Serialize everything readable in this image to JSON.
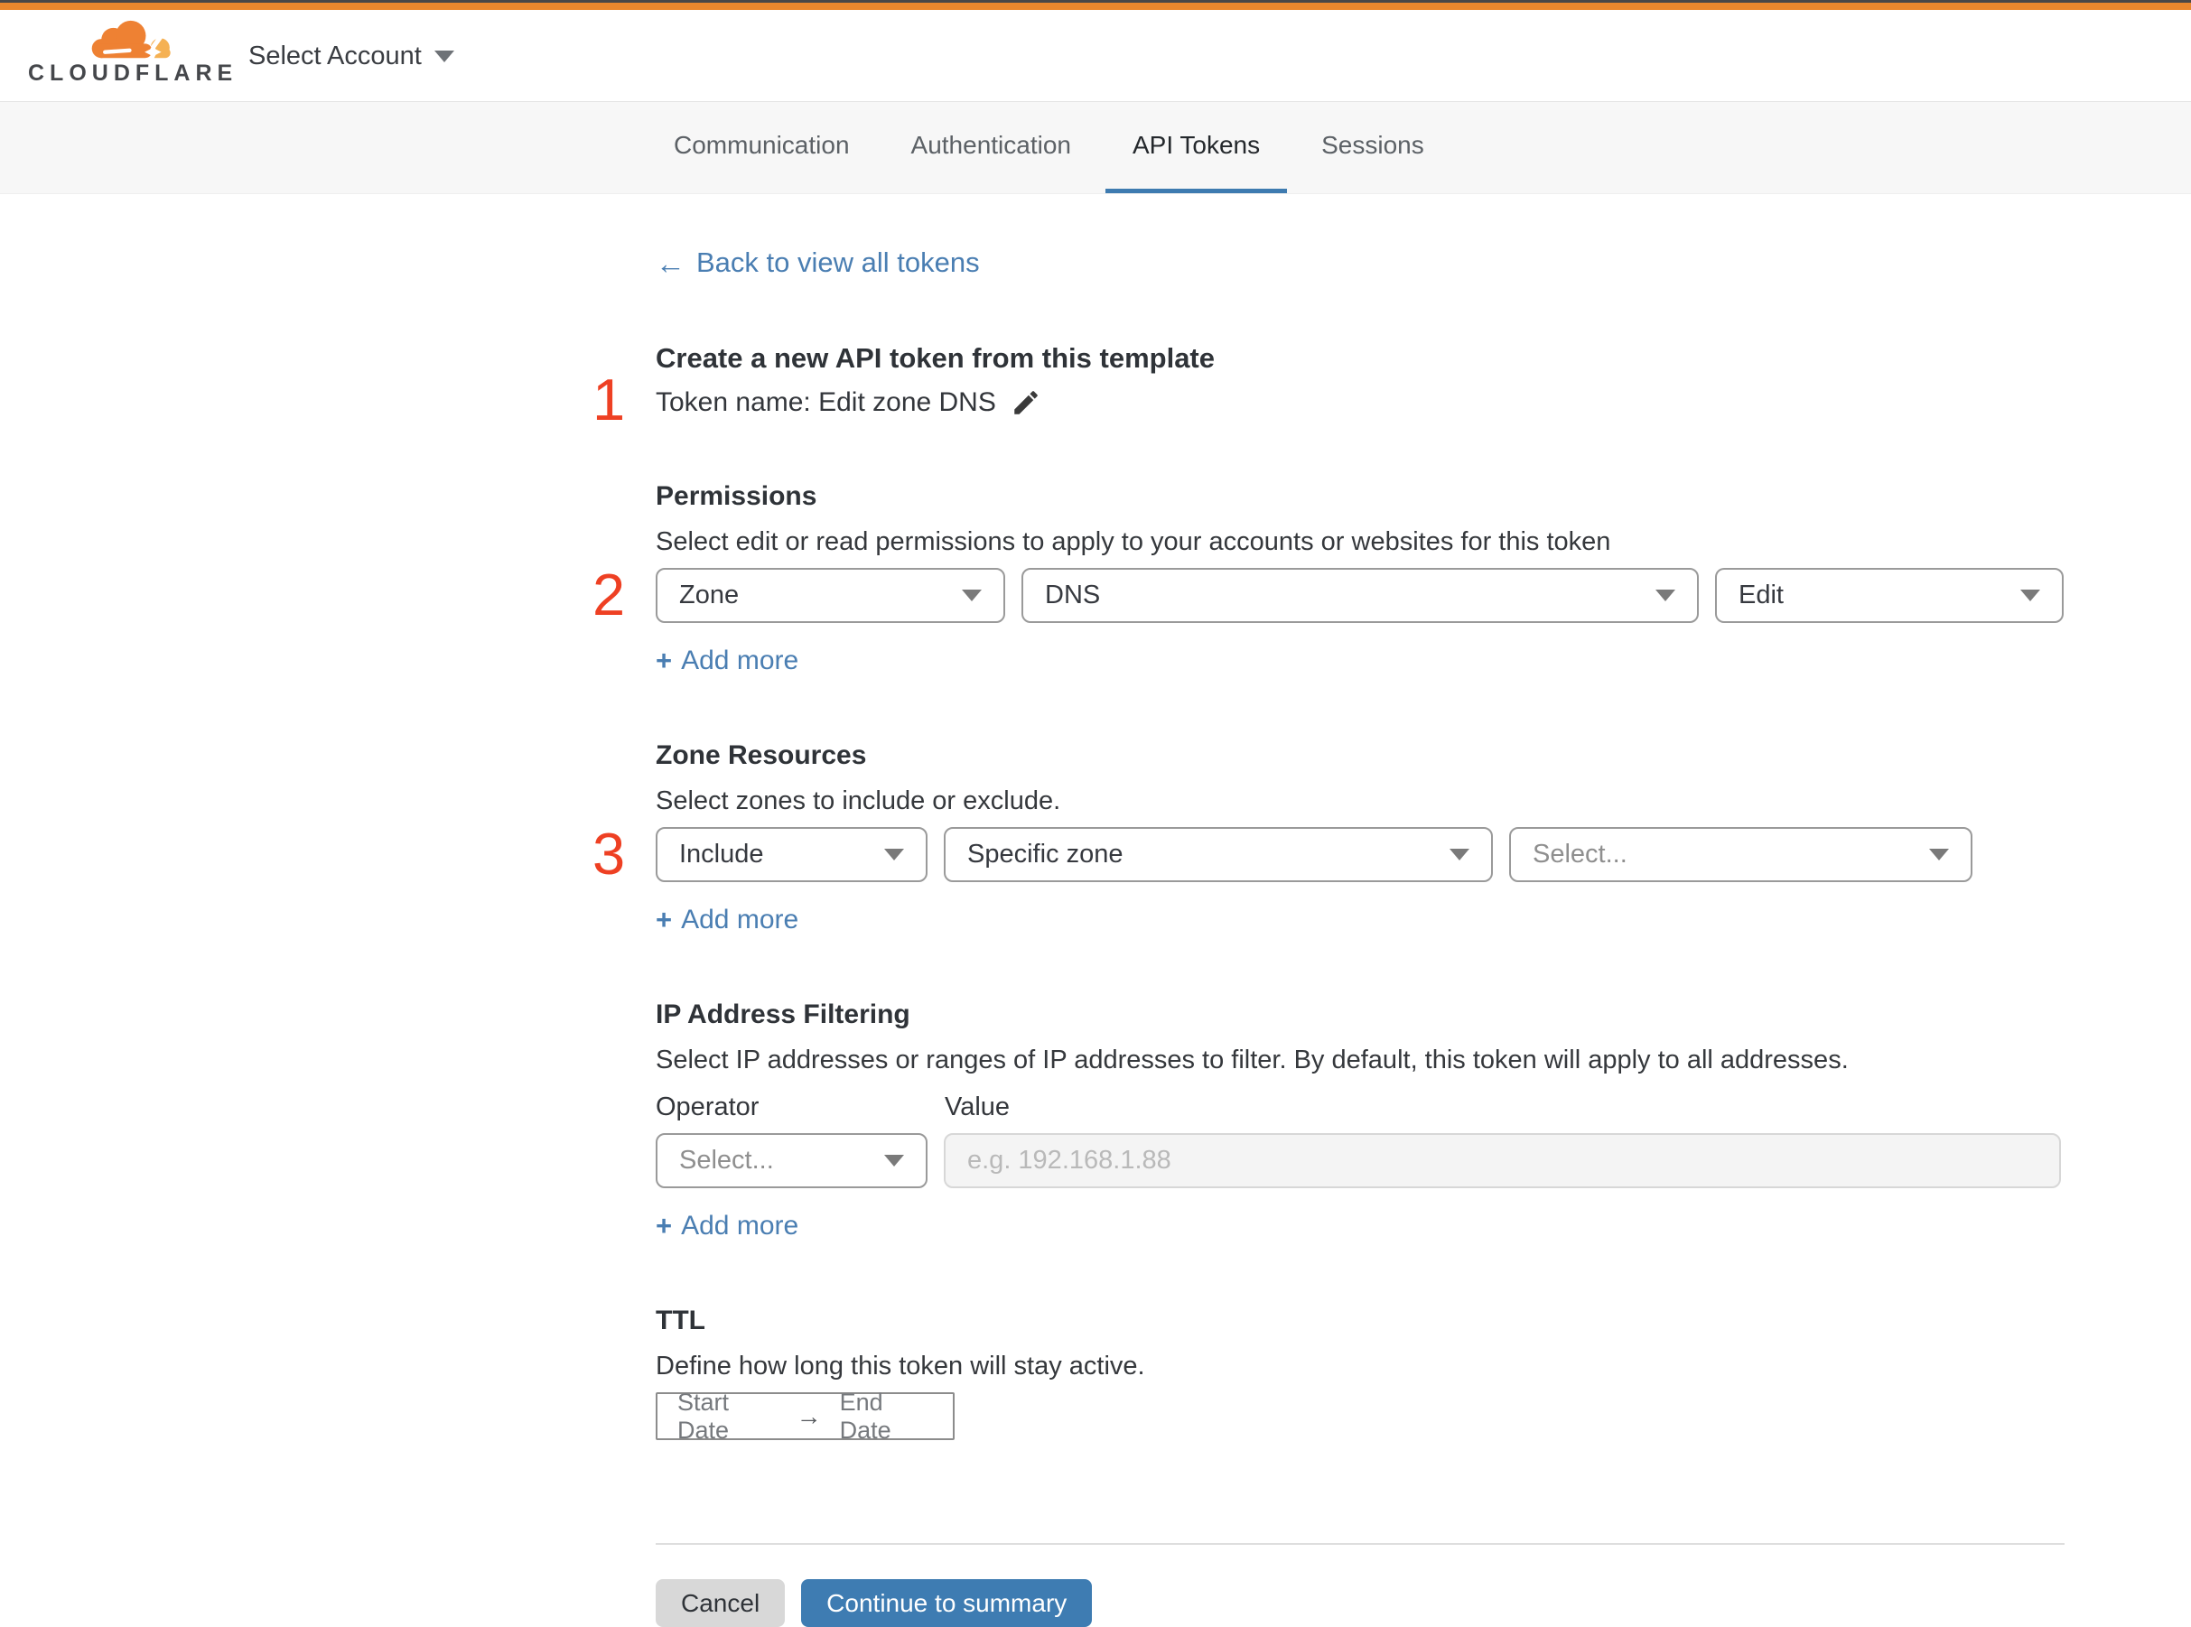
{
  "header": {
    "logo_text": "CLOUDFLARE",
    "account_selector": "Select Account"
  },
  "tabs": {
    "items": [
      {
        "label": "Communication",
        "active": false
      },
      {
        "label": "Authentication",
        "active": false
      },
      {
        "label": "API Tokens",
        "active": true
      },
      {
        "label": "Sessions",
        "active": false
      }
    ]
  },
  "back_link": {
    "label": "Back to view all tokens"
  },
  "icons": {
    "back_arrow": "←",
    "plus": "+",
    "range_arrow": "→"
  },
  "steps": {
    "one": "1",
    "two": "2",
    "three": "3"
  },
  "intro": {
    "heading": "Create a new API token from this template",
    "token_name": "Token name: Edit zone DNS"
  },
  "permissions": {
    "title": "Permissions",
    "description": "Select edit or read permissions to apply to your accounts or websites for this token",
    "selects": [
      {
        "value": "Zone"
      },
      {
        "value": "DNS"
      },
      {
        "value": "Edit"
      }
    ],
    "add_more": "Add more"
  },
  "zone_resources": {
    "title": "Zone Resources",
    "description": "Select zones to include or exclude.",
    "selects": [
      {
        "value": "Include"
      },
      {
        "value": "Specific zone"
      },
      {
        "value": "Select..."
      }
    ],
    "add_more": "Add more"
  },
  "ip_filtering": {
    "title": "IP Address Filtering",
    "description": "Select IP addresses or ranges of IP addresses to filter. By default, this token will apply to all addresses.",
    "operator_label": "Operator",
    "value_label": "Value",
    "operator_placeholder": "Select...",
    "value_placeholder": "e.g. 192.168.1.88",
    "add_more": "Add more"
  },
  "ttl": {
    "title": "TTL",
    "description": "Define how long this token will stay active.",
    "start_date": "Start Date",
    "end_date": "End Date"
  },
  "footer": {
    "cancel": "Cancel",
    "continue": "Continue to summary"
  },
  "colors": {
    "brand_orange": "#e8872d",
    "step_number_red": "#ee4023",
    "link_blue": "#4a7eb2",
    "button_blue": "#3e7cb2",
    "active_tab_underline": "#3e7bb0"
  }
}
